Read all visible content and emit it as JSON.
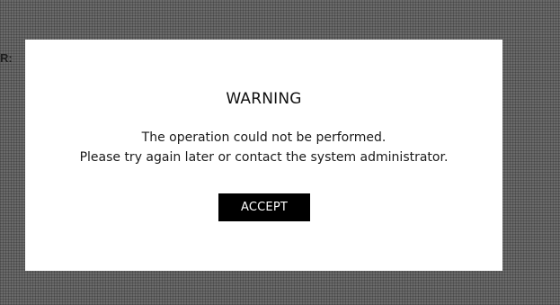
{
  "background": {
    "fragment_text": "R:"
  },
  "dialog": {
    "title": "WARNING",
    "message_line_1": "The operation could not be performed.",
    "message_line_2": "Please try again later or contact the system administrator.",
    "accept_label": "ACCEPT"
  },
  "colors": {
    "overlay": "#6a6a6a",
    "dialog_background": "#ffffff",
    "button_background": "#000000",
    "button_text": "#ffffff",
    "text": "#111111"
  }
}
